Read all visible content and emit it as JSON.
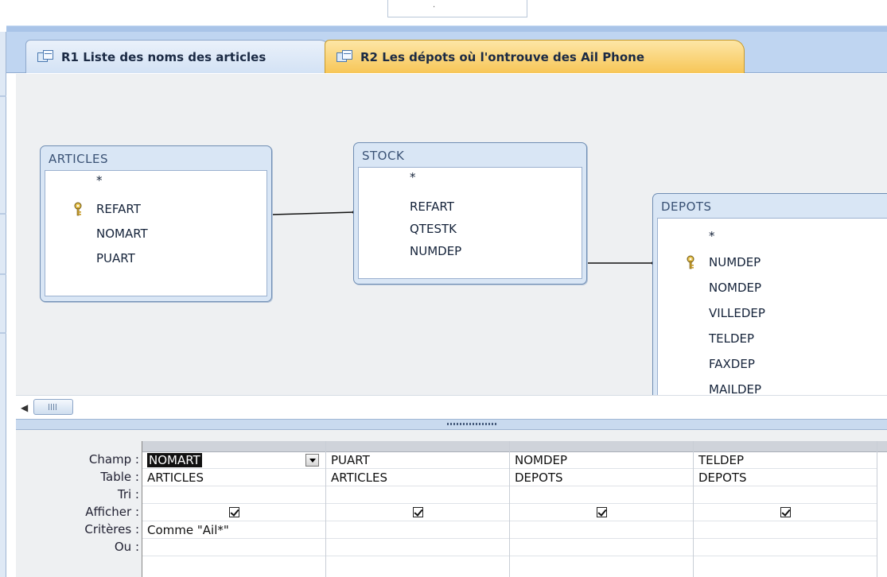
{
  "window": {
    "top_box_text": "."
  },
  "tabs": [
    {
      "label": "R1 Liste des noms des articles",
      "active": false
    },
    {
      "label": "R2 Les dépots où l'ontrouve des Ail Phone",
      "active": true
    }
  ],
  "tables": {
    "articles": {
      "title": "ARTICLES",
      "fields": [
        "*",
        "REFART",
        "NOMART",
        "PUART"
      ]
    },
    "stock": {
      "title": "STOCK",
      "fields": [
        "*",
        "REFART",
        "QTESTK",
        "NUMDEP"
      ]
    },
    "depots": {
      "title": "DEPOTS",
      "fields": [
        "*",
        "NUMDEP",
        "NOMDEP",
        "VILLEDEP",
        "TELDEP",
        "FAXDEP",
        "MAILDEP"
      ]
    }
  },
  "grid": {
    "row_labels": {
      "champ": "Champ :",
      "table": "Table :",
      "tri": "Tri :",
      "afficher": "Afficher :",
      "criteres": "Critères :",
      "ou": "Ou :"
    },
    "columns": [
      {
        "champ": "NOMART",
        "table": "ARTICLES",
        "tri": "",
        "afficher": true,
        "criteres": "Comme \"Ail*\""
      },
      {
        "champ": "PUART",
        "table": "ARTICLES",
        "tri": "",
        "afficher": true,
        "criteres": ""
      },
      {
        "champ": "NOMDEP",
        "table": "DEPOTS",
        "tri": "",
        "afficher": true,
        "criteres": ""
      },
      {
        "champ": "TELDEP",
        "table": "DEPOTS",
        "tri": "",
        "afficher": true,
        "criteres": ""
      }
    ]
  },
  "colors": {
    "active_tab": "#f7c657",
    "tab_strip": "#bfd5f1",
    "design_bg": "#eef0f2",
    "table_frame": "#d9e6f5"
  },
  "icons": [
    "query-icon",
    "key-icon",
    "scroll-left-arrow-icon",
    "dropdown-arrow-icon",
    "checkbox-checked-icon"
  ]
}
